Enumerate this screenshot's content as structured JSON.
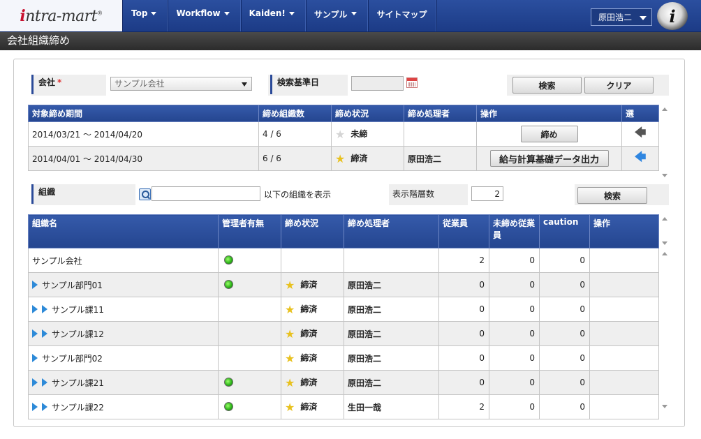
{
  "header": {
    "logo_text": "intra-mart",
    "menu": [
      {
        "label": "Top"
      },
      {
        "label": "Workflow"
      },
      {
        "label": "Kaiden!"
      },
      {
        "label": "サンプル"
      },
      {
        "label": "サイトマップ"
      }
    ],
    "user_name": "原田浩二"
  },
  "page_title": "会社組織締め",
  "search": {
    "company_label": "会社",
    "required_mark": "*",
    "company_value": "サンプル会社",
    "date_label": "検索基準日",
    "date_value": "",
    "search_button": "検索",
    "clear_button": "クリア"
  },
  "period_table": {
    "headers": [
      "対象締め期間",
      "締め組織数",
      "締め状況",
      "締め処理者",
      "操作",
      "選"
    ],
    "rows": [
      {
        "period": "2014/03/21 ～ 2014/04/20",
        "count": "4 / 6",
        "status": "未締",
        "status_done": false,
        "processor": "",
        "action": "締め"
      },
      {
        "period": "2014/04/01 ～ 2014/04/30",
        "count": "6 / 6",
        "status": "締済",
        "status_done": true,
        "processor": "原田浩二",
        "action": "給与計算基礎データ出力"
      }
    ]
  },
  "org_filter": {
    "label": "組織",
    "search_value": "",
    "suffix": "以下の組織を表示",
    "depth_label": "表示階層数",
    "depth_value": "2",
    "search_button": "検索"
  },
  "org_table": {
    "headers": [
      "組織名",
      "管理者有無",
      "締め状況",
      "締め処理者",
      "従業員",
      "未締め従業員",
      "caution",
      "操作"
    ],
    "rows": [
      {
        "name": "サンプル会社",
        "level": 0,
        "admin": true,
        "status": "",
        "processor": "",
        "employees": "2",
        "unclosed": "0",
        "caution": "0"
      },
      {
        "name": "サンプル部門01",
        "level": 1,
        "admin": true,
        "status": "締済",
        "processor": "原田浩二",
        "employees": "0",
        "unclosed": "0",
        "caution": "0"
      },
      {
        "name": "サンプル課11",
        "level": 2,
        "admin": false,
        "status": "締済",
        "processor": "原田浩二",
        "employees": "0",
        "unclosed": "0",
        "caution": "0"
      },
      {
        "name": "サンプル課12",
        "level": 2,
        "admin": false,
        "status": "締済",
        "processor": "原田浩二",
        "employees": "0",
        "unclosed": "0",
        "caution": "0"
      },
      {
        "name": "サンプル部門02",
        "level": 1,
        "admin": false,
        "status": "締済",
        "processor": "原田浩二",
        "employees": "0",
        "unclosed": "0",
        "caution": "0"
      },
      {
        "name": "サンプル課21",
        "level": 2,
        "admin": true,
        "status": "締済",
        "processor": "原田浩二",
        "employees": "0",
        "unclosed": "0",
        "caution": "0"
      },
      {
        "name": "サンプル課22",
        "level": 2,
        "admin": true,
        "status": "締済",
        "processor": "生田一哉",
        "employees": "2",
        "unclosed": "0",
        "caution": "0"
      }
    ]
  },
  "icons": {
    "calendar": "calendar-icon",
    "search": "search-icon",
    "star_done": "star-filled-icon",
    "star_open": "star-empty-icon",
    "lamp": "green-lamp-icon",
    "expand": "expand-triangle-icon",
    "select": "left-arrow-icon"
  },
  "colors": {
    "header_blue": "#24458f",
    "title_dark": "#2b2b2b",
    "star": "#e8c11e",
    "lamp_green": "#2fb51b",
    "arrow_blue": "#2f86e0"
  }
}
